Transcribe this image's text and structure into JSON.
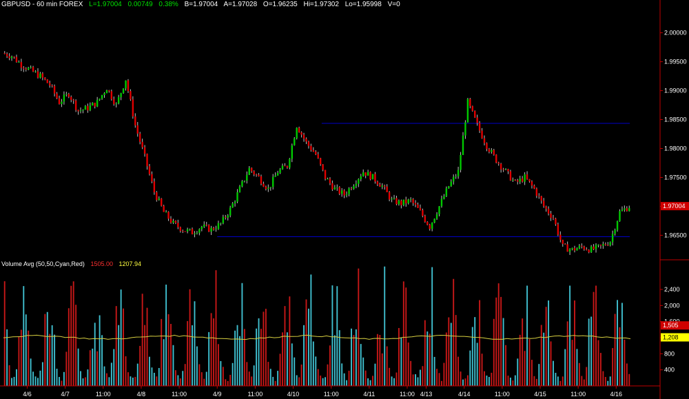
{
  "header": {
    "symbol": "GBPUSD - 60 min  FOREX",
    "last": "L=1.97004",
    "change": "0.00749",
    "change_pct": "0.38%",
    "bid": "B=1.97004",
    "ask": "A=1.97028",
    "open": "O=1.96235",
    "high": "Hi=1.97302",
    "low": "Lo=1.95998",
    "volume": "V=0"
  },
  "volume_header": {
    "label": "Volume Avg (50,50,Cyan,Red)",
    "value_red": "1505.00",
    "value_yellow": "1207.94"
  },
  "colors": {
    "background": "#000000",
    "up_candle": "#00c800",
    "down_candle": "#e00000",
    "wick": "#c0c0c0",
    "trendline": "#0000c8",
    "volume_up": "#40c0d0",
    "volume_down": "#c81818",
    "volume_avg": "#d8d040",
    "axis": "#c00000",
    "last_price_flag": "#d00000",
    "avg_flag": "#ffff00"
  },
  "chart_data": [
    {
      "type": "candlestick",
      "title": "GBPUSD - 60 min FOREX",
      "ylim": [
        1.961,
        2.004
      ],
      "y_ticks": [
        "2.00000",
        "1.99500",
        "1.99000",
        "1.98500",
        "1.98000",
        "1.97500",
        "1.97000",
        "1.96500"
      ],
      "y_tick_values": [
        2.0,
        1.995,
        1.99,
        1.985,
        1.98,
        1.975,
        1.97,
        1.965
      ],
      "last_price_label": "1.97004",
      "last_price": 1.97004,
      "x_tick_labels": [
        "4/6",
        "4/7",
        "11:00",
        "4/8",
        "11:00",
        "4/9",
        "11:00",
        "4/10",
        "11:00",
        "4/11",
        "11:00",
        "4/13",
        "4/14",
        "11:00",
        "4/15",
        "11:00",
        "4/16"
      ],
      "x_tick_bars": [
        2,
        6,
        10,
        14,
        18,
        22,
        26,
        30,
        34,
        38,
        42,
        44,
        48,
        52,
        56,
        60,
        64
      ],
      "bars_total": 66,
      "closes": [
        1.996,
        1.9945,
        1.9935,
        1.9925,
        1.991,
        1.988,
        1.9895,
        1.9865,
        1.987,
        1.988,
        1.9905,
        1.9875,
        1.992,
        1.984,
        1.9785,
        1.9725,
        1.969,
        1.967,
        1.966,
        1.9655,
        1.9665,
        1.966,
        1.967,
        1.9695,
        1.973,
        1.9765,
        1.975,
        1.973,
        1.976,
        1.977,
        1.984,
        1.981,
        1.979,
        1.975,
        1.973,
        1.972,
        1.974,
        1.976,
        1.975,
        1.9735,
        1.971,
        1.9705,
        1.971,
        1.969,
        1.9665,
        1.97,
        1.9735,
        1.976,
        1.988,
        1.984,
        1.9805,
        1.978,
        1.976,
        1.974,
        1.975,
        1.973,
        1.97,
        1.968,
        1.963,
        1.9625,
        1.963,
        1.9625,
        1.963,
        1.964,
        1.969,
        1.97
      ],
      "trendlines": [
        {
          "price": 1.98435,
          "from_bar": 33,
          "to_bar": 66
        },
        {
          "price": 1.96475,
          "from_bar": 22,
          "to_bar": 66
        }
      ]
    },
    {
      "type": "bar",
      "title": "Volume Avg (50,50,Cyan,Red)",
      "ylim": [
        0,
        3000
      ],
      "y_ticks": [
        "2,400",
        "2,000",
        "1,600",
        "1,200",
        "800",
        "400"
      ],
      "y_tick_values": [
        2400,
        2000,
        1600,
        1200,
        800,
        400
      ],
      "flag_red": "1,505",
      "flag_red_value": 1505,
      "flag_yellow": "1,208",
      "flag_yellow_value": 1208,
      "moving_average": 1207.94,
      "pattern_values": [
        2500,
        1200,
        600,
        300,
        200,
        500,
        1400,
        1900,
        2200,
        2600,
        1700,
        900,
        400,
        250,
        180,
        350,
        800,
        1500,
        2100,
        1300
      ]
    }
  ]
}
